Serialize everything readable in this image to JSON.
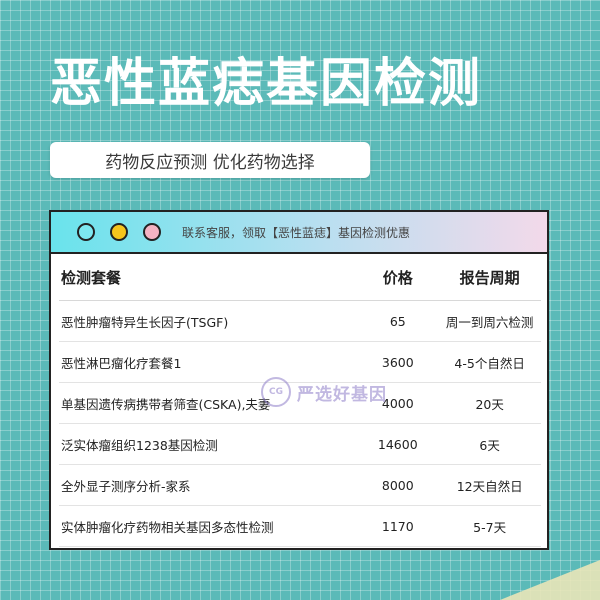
{
  "title": "恶性蓝痣基因检测",
  "subtitle": "药物反应预测 优化药物选择",
  "window": {
    "notice": "联系客服，领取【恶性蓝痣】基因检测优惠",
    "dots": [
      "#7de8f0",
      "#f6c51d",
      "#f4b3c3"
    ]
  },
  "table": {
    "headers": {
      "name": "检测套餐",
      "price": "价格",
      "period": "报告周期"
    },
    "rows": [
      {
        "name": "恶性肿瘤特异生长因子(TSGF)",
        "price": "65",
        "period": "周一到周六检测"
      },
      {
        "name": "恶性淋巴瘤化疗套餐1",
        "price": "3600",
        "period": "4-5个自然日"
      },
      {
        "name": "单基因遗传病携带者筛查(CSKA),夫妻",
        "price": "4000",
        "period": "20天"
      },
      {
        "name": "泛实体瘤组织1238基因检测",
        "price": "14600",
        "period": "6天"
      },
      {
        "name": "全外显子测序分析-家系",
        "price": "8000",
        "period": "12天自然日"
      },
      {
        "name": "实体肿瘤化疗药物相关基因多态性检测",
        "price": "1170",
        "period": "5-7天"
      }
    ]
  },
  "watermark": {
    "logo": "CG",
    "text": "严选好基因"
  }
}
